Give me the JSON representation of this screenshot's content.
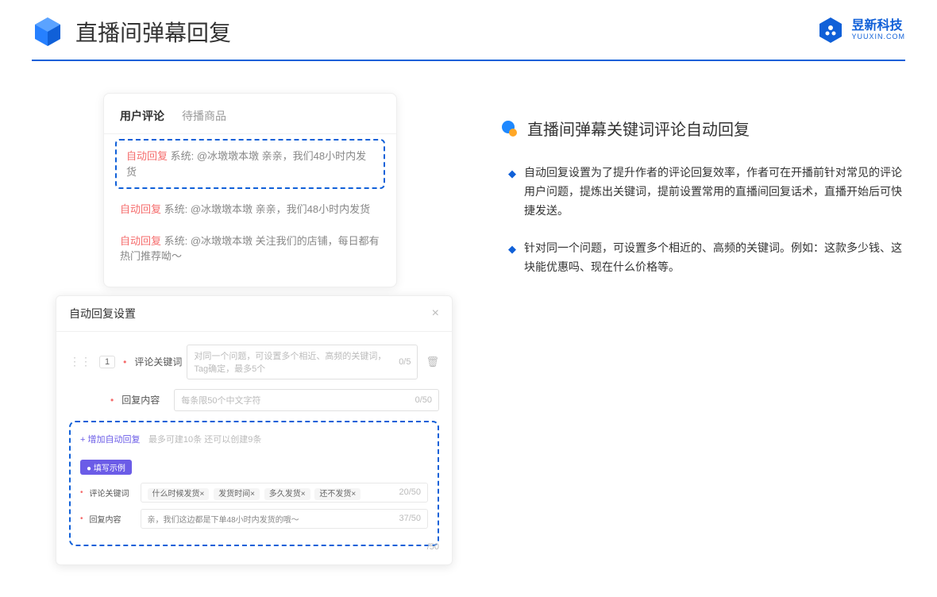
{
  "header": {
    "title": "直播间弹幕回复",
    "logo_cn": "昱新科技",
    "logo_en": "YUUXIN.COM"
  },
  "comments": {
    "tabs": [
      "用户评论",
      "待播商品"
    ],
    "activeTab": 0,
    "list": [
      {
        "highlighted": true,
        "tag": "自动回复",
        "text": "系统: @冰墩墩本墩 亲亲，我们48小时内发货"
      },
      {
        "highlighted": false,
        "tag": "自动回复",
        "text": "系统: @冰墩墩本墩 亲亲，我们48小时内发货"
      },
      {
        "highlighted": false,
        "tag": "自动回复",
        "text": "系统: @冰墩墩本墩 关注我们的店铺，每日都有热门推荐呦～"
      }
    ]
  },
  "settings": {
    "title": "自动回复设置",
    "row_num": "1",
    "keyword_label": "评论关键词",
    "keyword_placeholder": "对同一个问题，可设置多个相近、高频的关键词，Tag确定，最多5个",
    "keyword_counter": "0/5",
    "content_label": "回复内容",
    "content_placeholder": "每条限50个中文字符",
    "content_counter": "0/50",
    "remaining": "/50",
    "add_link": "+ 增加自动回复",
    "add_hint": "最多可建10条 还可以创建9条",
    "example_badge": "● 填写示例",
    "ex_keyword_label": "评论关键词",
    "ex_tags": [
      "什么时候发货×",
      "发货时间×",
      "多久发货×",
      "还不发货×"
    ],
    "ex_keyword_counter": "20/50",
    "ex_content_label": "回复内容",
    "ex_content_value": "亲，我们这边都是下单48小时内发货的哦～",
    "ex_content_counter": "37/50"
  },
  "right": {
    "section_title": "直播间弹幕关键词评论自动回复",
    "bullets": [
      "自动回复设置为了提升作者的评论回复效率，作者可在开播前针对常见的评论用户问题，提炼出关键词，提前设置常用的直播间回复话术，直播开始后可快捷发送。",
      "针对同一个问题，可设置多个相近的、高频的关键词。例如：这款多少钱、这块能优惠吗、现在什么价格等。"
    ]
  }
}
